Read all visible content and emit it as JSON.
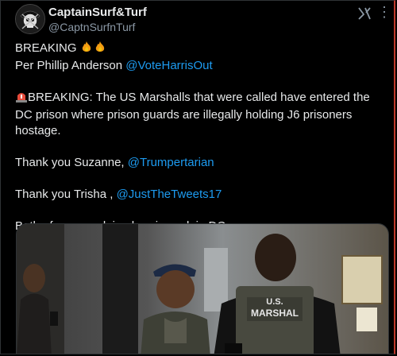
{
  "author": {
    "display_name": "CaptainSurf&Turf",
    "handle": "@CaptnSurfnTurf",
    "avatar_icon": "pirate-skull-avatar-icon"
  },
  "header_icons": [
    "x-logo-icon",
    "more-options-icon"
  ],
  "tweet": {
    "line1_text": "BREAKING",
    "line1_emoji": "fire-emoji-icon",
    "line2_text": "Per Phillip Anderson ",
    "line2_mention": "@VoteHarrisOut",
    "para2_emoji": "siren-emoji-icon",
    "para2_text": "BREAKING: The US Marshalls that were called have entered the DC prison where prison guards are illegally holding J6 prisoners hostage.",
    "thanks1_text": "Thank you Suzanne, ",
    "thanks1_mention": "@Trumpertarian",
    "thanks2_text": "Thank you Trisha , ",
    "thanks2_mention": "@JustTheTweets17",
    "closing_text": "Both of you are doing heroic work in DC."
  },
  "media": {
    "vest_label_line1": "U.S.",
    "vest_label_line2": "MARSHAL"
  },
  "colors": {
    "link": "#1d9bf0",
    "text": "#e7e9ea",
    "muted": "#8b98a5",
    "background": "#000000"
  }
}
